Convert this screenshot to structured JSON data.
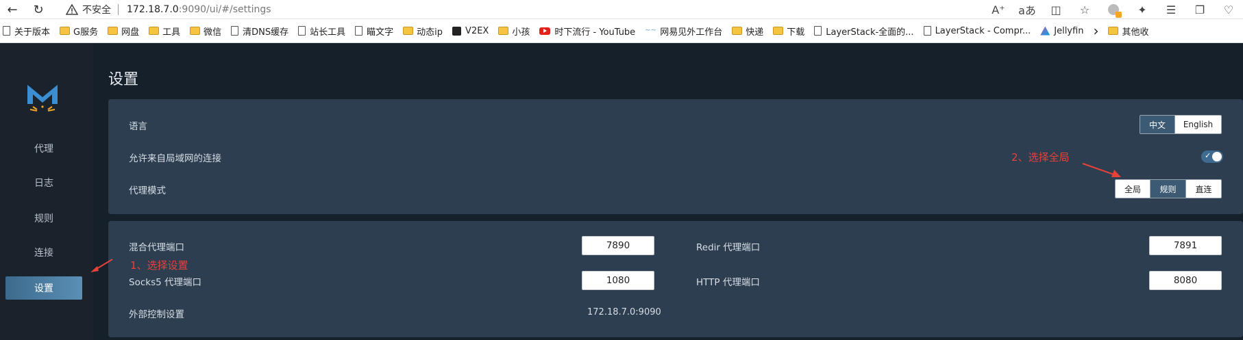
{
  "browser": {
    "insecure_label": "不安全",
    "url_host": "172.18.7.0",
    "url_rest": ":9090/ui/#/settings",
    "bookmarks": [
      {
        "icon": "page-icon",
        "label": "关于版本"
      },
      {
        "icon": "folder-icon",
        "label": "G服务"
      },
      {
        "icon": "folder-icon",
        "label": "网盘"
      },
      {
        "icon": "folder-icon",
        "label": "工具"
      },
      {
        "icon": "folder-icon",
        "label": "微信"
      },
      {
        "icon": "page-icon",
        "label": "清DNS缓存"
      },
      {
        "icon": "page-icon",
        "label": "站长工具"
      },
      {
        "icon": "page-icon",
        "label": "瞄文字"
      },
      {
        "icon": "folder-icon",
        "label": "动态ip"
      },
      {
        "icon": "v2ex-icon",
        "label": "V2EX"
      },
      {
        "icon": "folder-icon",
        "label": "小孩"
      },
      {
        "icon": "youtube-icon",
        "label": "时下流行 - YouTube"
      },
      {
        "icon": "netease-icon",
        "label": "网易见外工作台"
      },
      {
        "icon": "folder-icon",
        "label": "快递"
      },
      {
        "icon": "folder-icon",
        "label": "下载"
      },
      {
        "icon": "page-icon",
        "label": "LayerStack-全面的..."
      },
      {
        "icon": "page-icon",
        "label": "LayerStack - Compr..."
      },
      {
        "icon": "jellyfin-icon",
        "label": "Jellyfin"
      }
    ],
    "more_bookmarks": "其他收"
  },
  "sidebar": {
    "items": [
      {
        "label": "代理",
        "active": false
      },
      {
        "label": "日志",
        "active": false
      },
      {
        "label": "规则",
        "active": false
      },
      {
        "label": "连接",
        "active": false
      },
      {
        "label": "设置",
        "active": true
      }
    ]
  },
  "page": {
    "title": "设置"
  },
  "general": {
    "language_label": "语言",
    "language_options": [
      "中文",
      "English"
    ],
    "language_selected": "中文",
    "lan_label": "允许来自局域网的连接",
    "lan_enabled": true,
    "mode_label": "代理模式",
    "mode_options": [
      "全局",
      "规则",
      "直连"
    ],
    "mode_selected": "规则"
  },
  "ports": {
    "mixed_label": "混合代理端口",
    "mixed_value": "7890",
    "redir_label": "Redir 代理端口",
    "redir_value": "7891",
    "socks_label": "Socks5 代理端口",
    "socks_value": "1080",
    "http_label": "HTTP 代理端口",
    "http_value": "8080",
    "external_label": "外部控制设置",
    "external_value": "172.18.7.0:9090"
  },
  "annotations": {
    "step1": "1、选择设置",
    "step2": "2、选择全局",
    "color": "#e8413a"
  }
}
